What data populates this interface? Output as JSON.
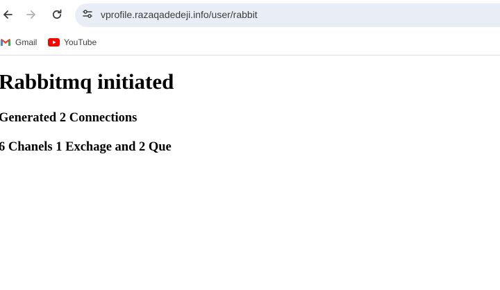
{
  "browser": {
    "url": "vprofile.razaqadedeji.info/user/rabbit",
    "icons": {
      "back": "back-arrow-icon",
      "forward": "forward-arrow-icon",
      "reload": "reload-icon",
      "site_info": "tune-icon"
    }
  },
  "bookmarks": [
    {
      "label": "Gmail",
      "icon": "gmail-icon"
    },
    {
      "label": "YouTube",
      "icon": "youtube-icon"
    }
  ],
  "page": {
    "heading": "Rabbitmq initiated",
    "line1": "Generated 2 Connections",
    "line2": "6 Chanels 1 Exchage and 2 Que"
  },
  "colors": {
    "omnibox_bg": "#e9eef6",
    "youtube_red": "#ff0000",
    "gmail_red": "#ea4335"
  }
}
